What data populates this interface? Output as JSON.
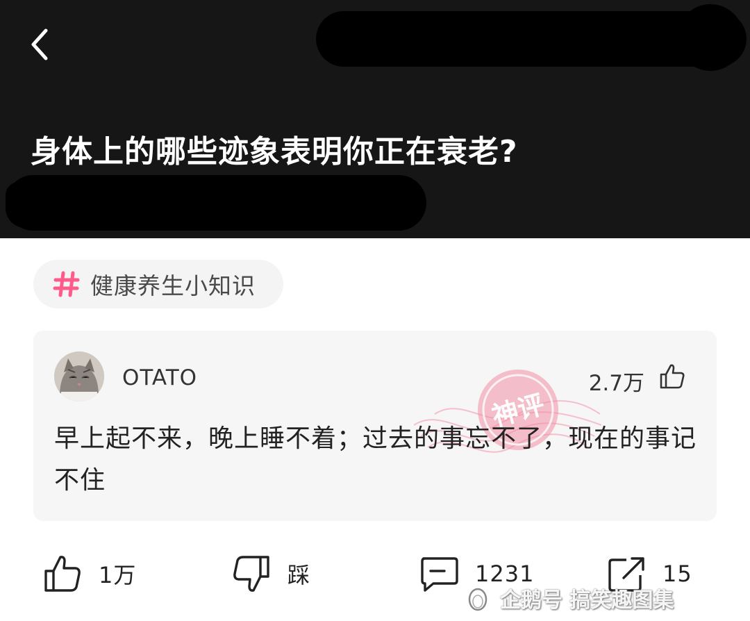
{
  "header": {
    "question_title": "身体上的哪些迹象表明你正在衰老?"
  },
  "topic_tag": {
    "label": "健康养生小知识",
    "icon": "hash-icon",
    "accent": "#ff5a8a"
  },
  "top_comment": {
    "username": "OTATO",
    "like_count": "2.7万",
    "text": "早上起不来，晚上睡不着；过去的事忘不了，现在的事记不住",
    "stamp_text": "神评",
    "stamp_color": "#f06a8a"
  },
  "actions": {
    "like_label": "1万",
    "dislike_label": "踩",
    "comment_label": "1231",
    "share_label": "15"
  },
  "watermark": {
    "text": "企鹅号 搞笑趣图集"
  }
}
